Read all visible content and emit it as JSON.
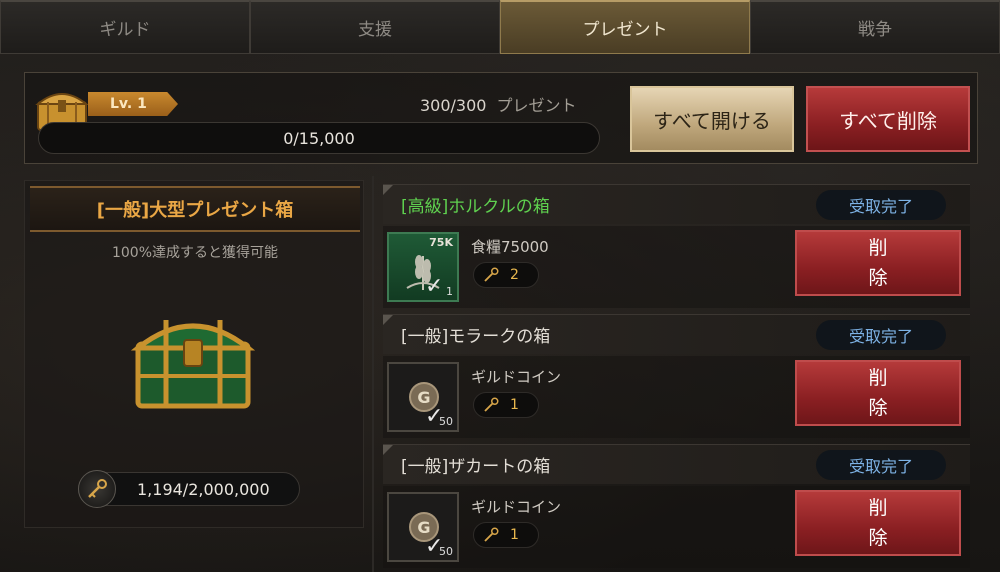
{
  "tabs": [
    {
      "label": "ギルド",
      "active": false
    },
    {
      "label": "支援",
      "active": false
    },
    {
      "label": "プレゼント",
      "active": true
    },
    {
      "label": "戦争",
      "active": false
    }
  ],
  "topbar": {
    "level": "Lv. 1",
    "gift_count": "300/300",
    "gift_label": "プレゼント",
    "progress_text": "0/15,000",
    "progress_fraction": 0,
    "open_all_label": "すべて開ける",
    "delete_all_label": "すべて削除"
  },
  "left_panel": {
    "title": "[一般]大型プレゼント箱",
    "subtitle": "100%達成すると獲得可能",
    "keys_text": "1,194/2,000,000"
  },
  "items": [
    {
      "title": "[高級]ホルクルの箱",
      "tier": "high",
      "status": "受取完了",
      "reward_name": "食糧75000",
      "thumb_top": "75K",
      "thumb_bottom": "1",
      "thumb_icon": "wheat-icon",
      "keys": "2",
      "delete_label_1": "削",
      "delete_label_2": "除"
    },
    {
      "title": "[一般]モラークの箱",
      "tier": "normal",
      "status": "受取完了",
      "reward_name": "ギルドコイン",
      "thumb_top": "",
      "thumb_bottom": "50",
      "thumb_icon": "guild-coin-icon",
      "keys": "1",
      "delete_label_1": "削",
      "delete_label_2": "除"
    },
    {
      "title": "[一般]ザカートの箱",
      "tier": "normal",
      "status": "受取完了",
      "reward_name": "ギルドコイン",
      "thumb_top": "",
      "thumb_bottom": "50",
      "thumb_icon": "guild-coin-icon",
      "keys": "1",
      "delete_label_1": "削",
      "delete_label_2": "除"
    }
  ],
  "colors": {
    "accent_gold": "#eaa745",
    "high_tier_green": "#5fd14f",
    "status_blue": "#7eb3e6",
    "delete_red": "#8a1f22"
  }
}
